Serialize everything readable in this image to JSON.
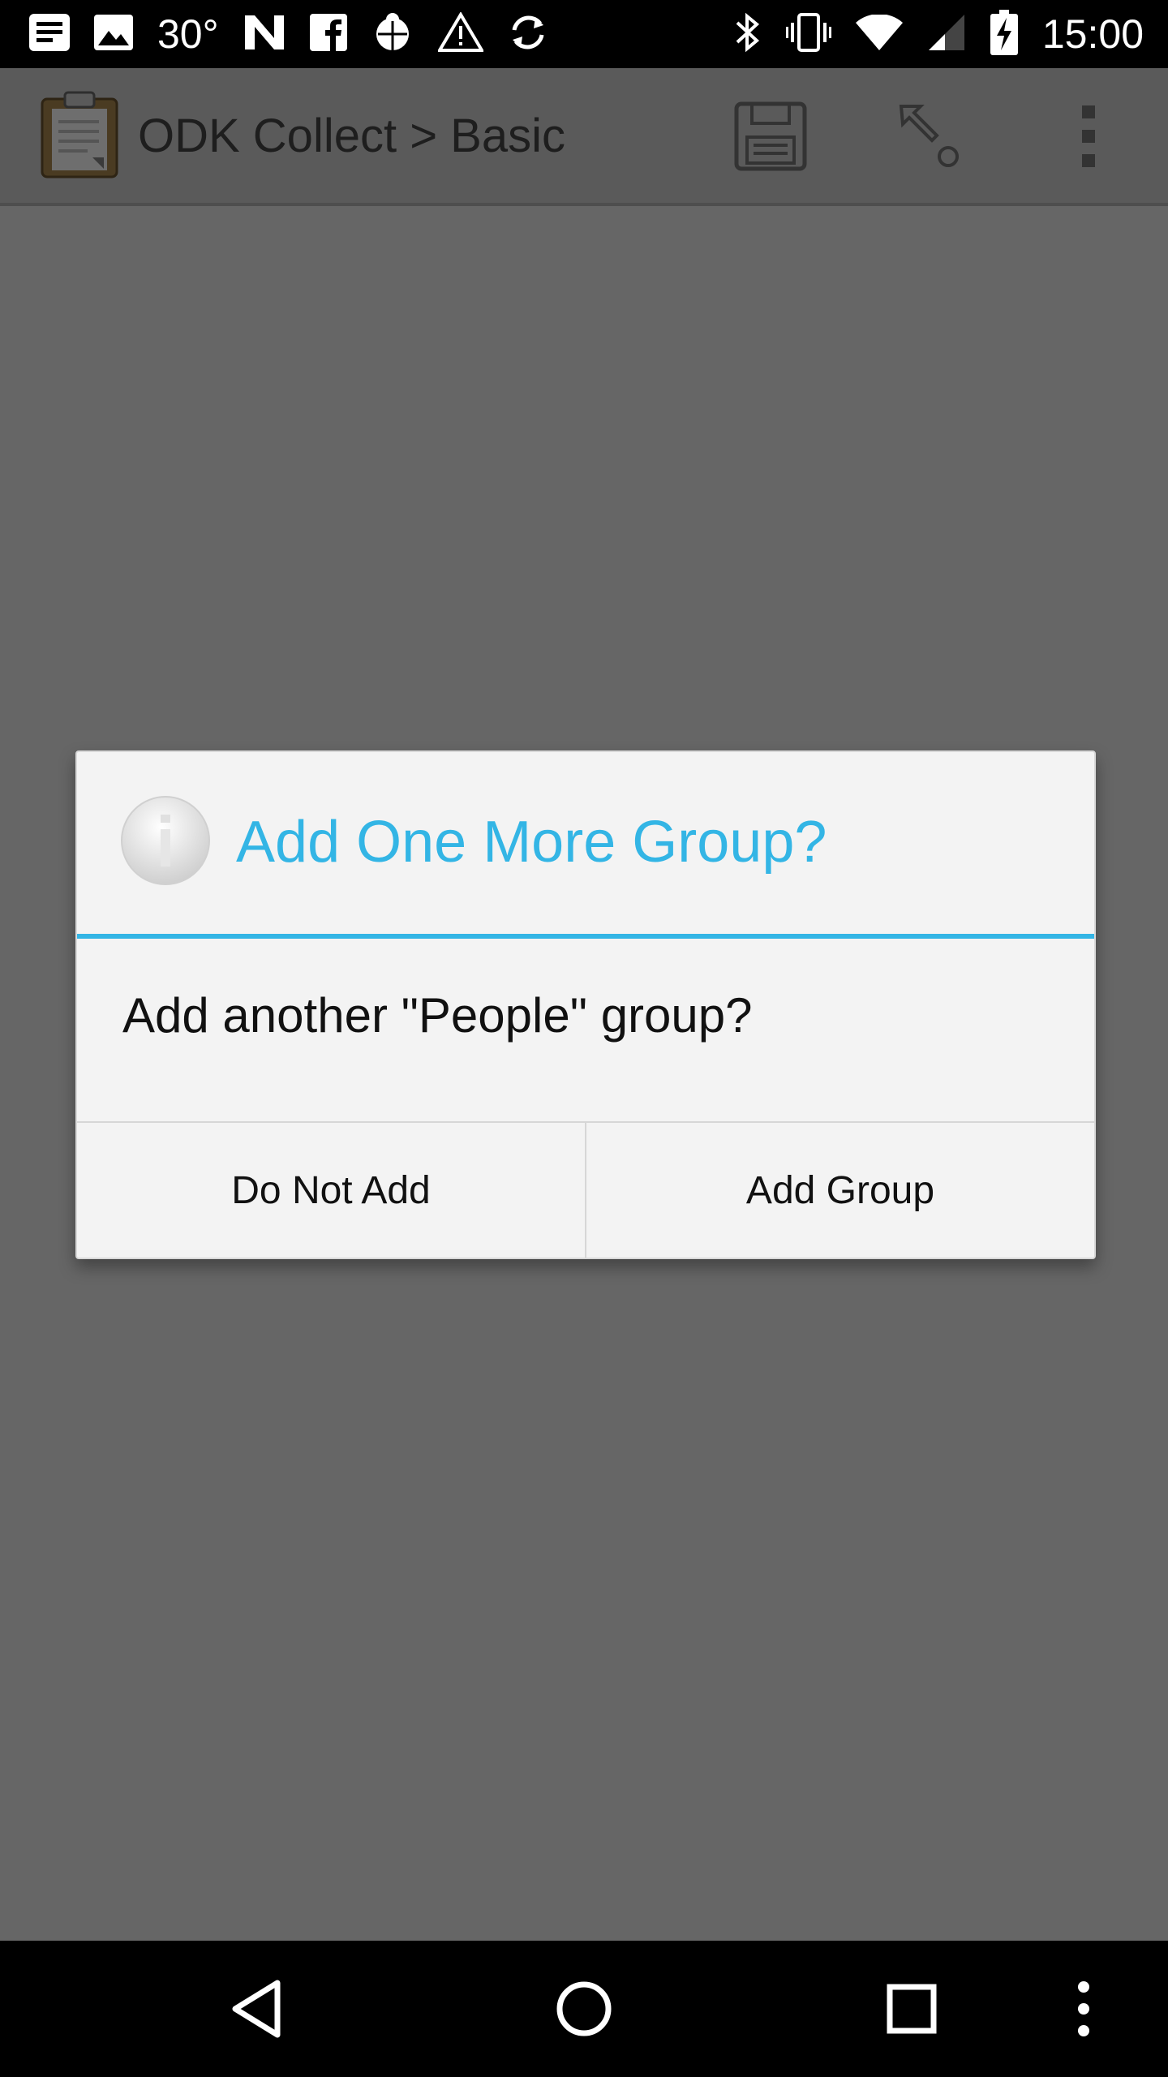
{
  "status_bar": {
    "temperature": "30°",
    "time": "15:00",
    "left_icons": [
      "notification-doc-icon",
      "image-icon",
      "temperature",
      "n-logo-icon",
      "facebook-icon",
      "bug-icon",
      "warning-icon",
      "sync-icon"
    ],
    "right_icons": [
      "bluetooth-icon",
      "vibrate-icon",
      "wifi-icon",
      "signal-icon",
      "battery-charging-icon"
    ]
  },
  "action_bar": {
    "title": "ODK Collect > Basic",
    "icons": [
      "app-logo-icon",
      "save-icon",
      "jump-icon",
      "overflow-menu-icon"
    ]
  },
  "dialog": {
    "title": "Add One More Group?",
    "message": "Add another \"People\" group?",
    "negative_label": "Do Not Add",
    "positive_label": "Add Group",
    "accent_color": "#33b5e5"
  },
  "nav_bar": {
    "icons": [
      "back-icon",
      "home-icon",
      "recents-icon",
      "menu-icon"
    ]
  },
  "colors": {
    "scrim": "#666666",
    "dialog_bg": "#f3f3f3",
    "accent": "#33b5e5"
  }
}
